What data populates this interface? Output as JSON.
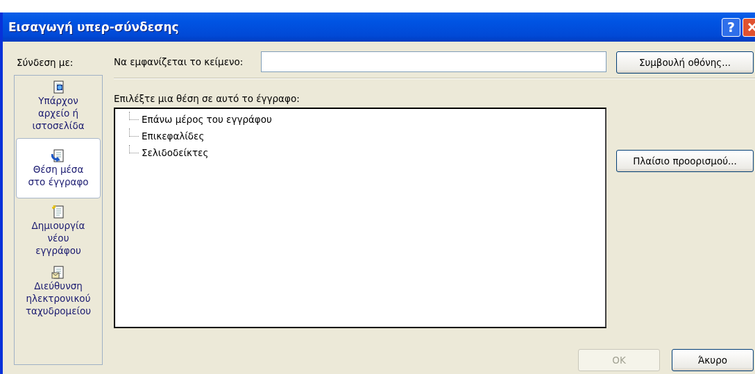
{
  "window": {
    "title": "Εισαγωγή υπερ-σύνδεσης",
    "help_button": "?"
  },
  "link_to": {
    "label": "Σύνδεση με:",
    "items": [
      {
        "kind": "file",
        "label": "Υπάρχον αρχείο ή ιστοσελίδα",
        "selected": false
      },
      {
        "kind": "place",
        "label": "Θέση μέσα στο έγγραφο",
        "selected": true
      },
      {
        "kind": "new",
        "label": "Δημιουργία νέου εγγράφου",
        "selected": false
      },
      {
        "kind": "email",
        "label": "Διεύθυνση ηλεκτρονικού ταχυδρομείου",
        "selected": false
      }
    ]
  },
  "text_to_display": {
    "label": "Να εμφανίζεται το κείμενο:"
  },
  "screen_tip_button": "Συμβουλή οθόνης...",
  "place": {
    "label": "Επιλέξτε μια θέση σε αυτό το έγγραφο:",
    "tree": [
      {
        "label": "Επάνω μέρος του εγγράφου"
      },
      {
        "label": "Επικεφαλίδες"
      },
      {
        "label": "Σελιδοδείκτες"
      }
    ]
  },
  "target_frame_button": "Πλαίσιο προορισμού...",
  "buttons": [
    {
      "label": "OK",
      "disabled": true
    },
    {
      "label": "Άκυρο",
      "disabled": false
    }
  ]
}
